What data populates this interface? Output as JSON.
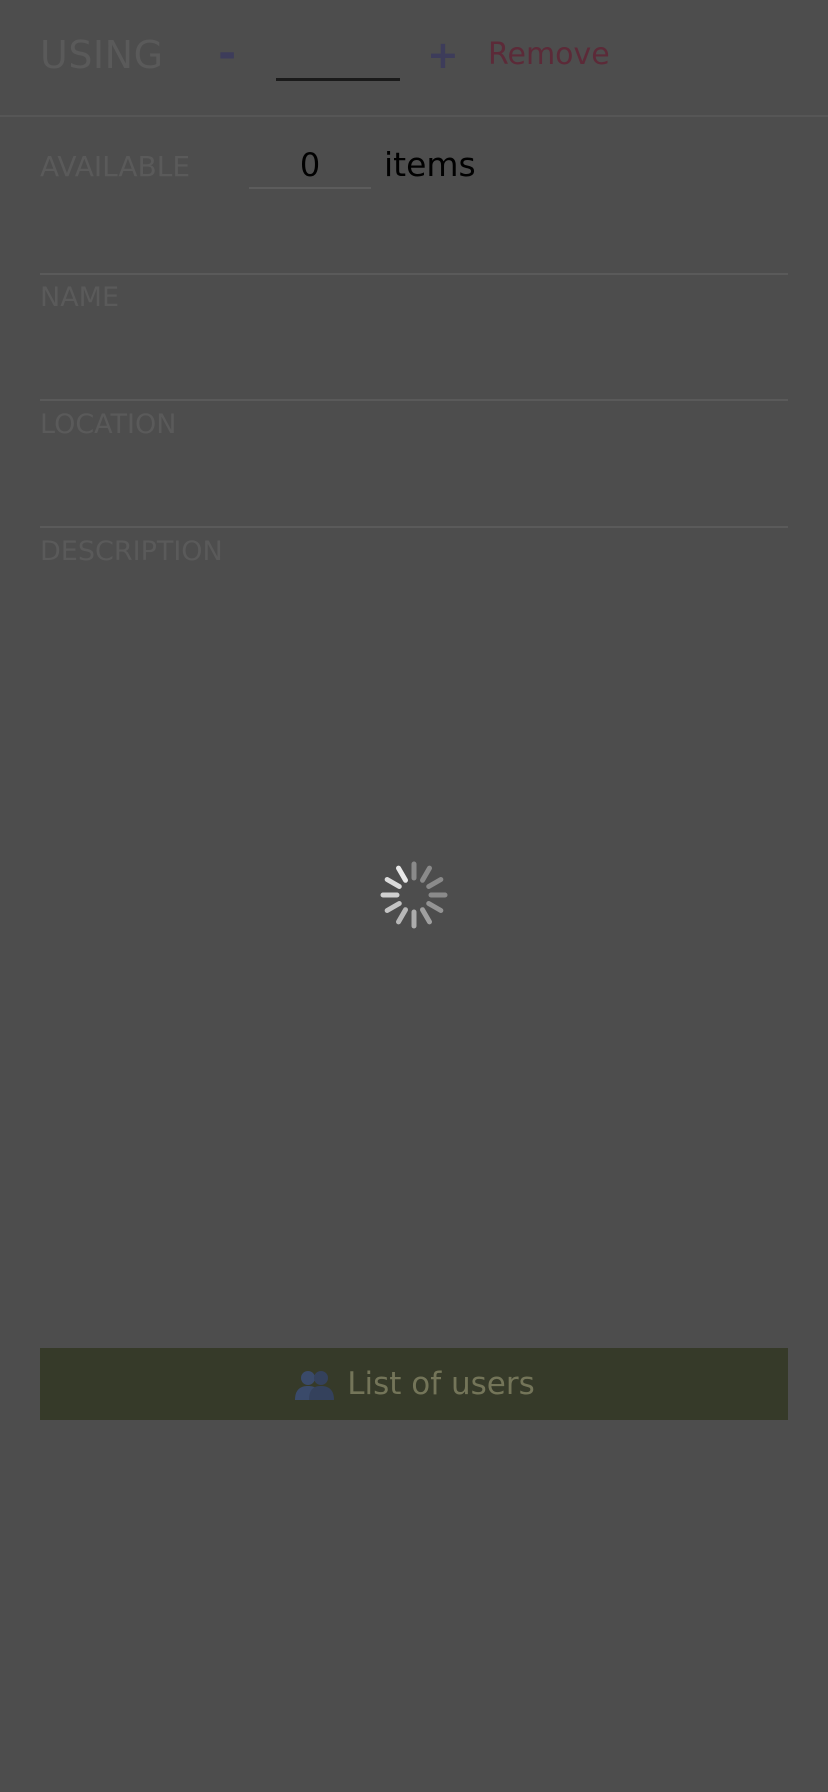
{
  "header": {
    "using_label": "USING",
    "minus_label": "-",
    "using_value": "",
    "plus_label": "+",
    "remove_label": "Remove"
  },
  "available": {
    "label": "AVAILABLE",
    "value": "0",
    "unit": "items"
  },
  "fields": {
    "name_label": "NAME",
    "location_label": "LOCATION",
    "description_label": "DESCRIPTION"
  },
  "loading": {
    "icon": "loading-spinner-icon"
  },
  "users_button": {
    "icon": "users-icon",
    "label": "List of users",
    "background": "#363a29"
  },
  "colors": {
    "overlay": "#4d4d4d",
    "remove": "#5c2a38",
    "stepper": "#3d3c5a"
  }
}
